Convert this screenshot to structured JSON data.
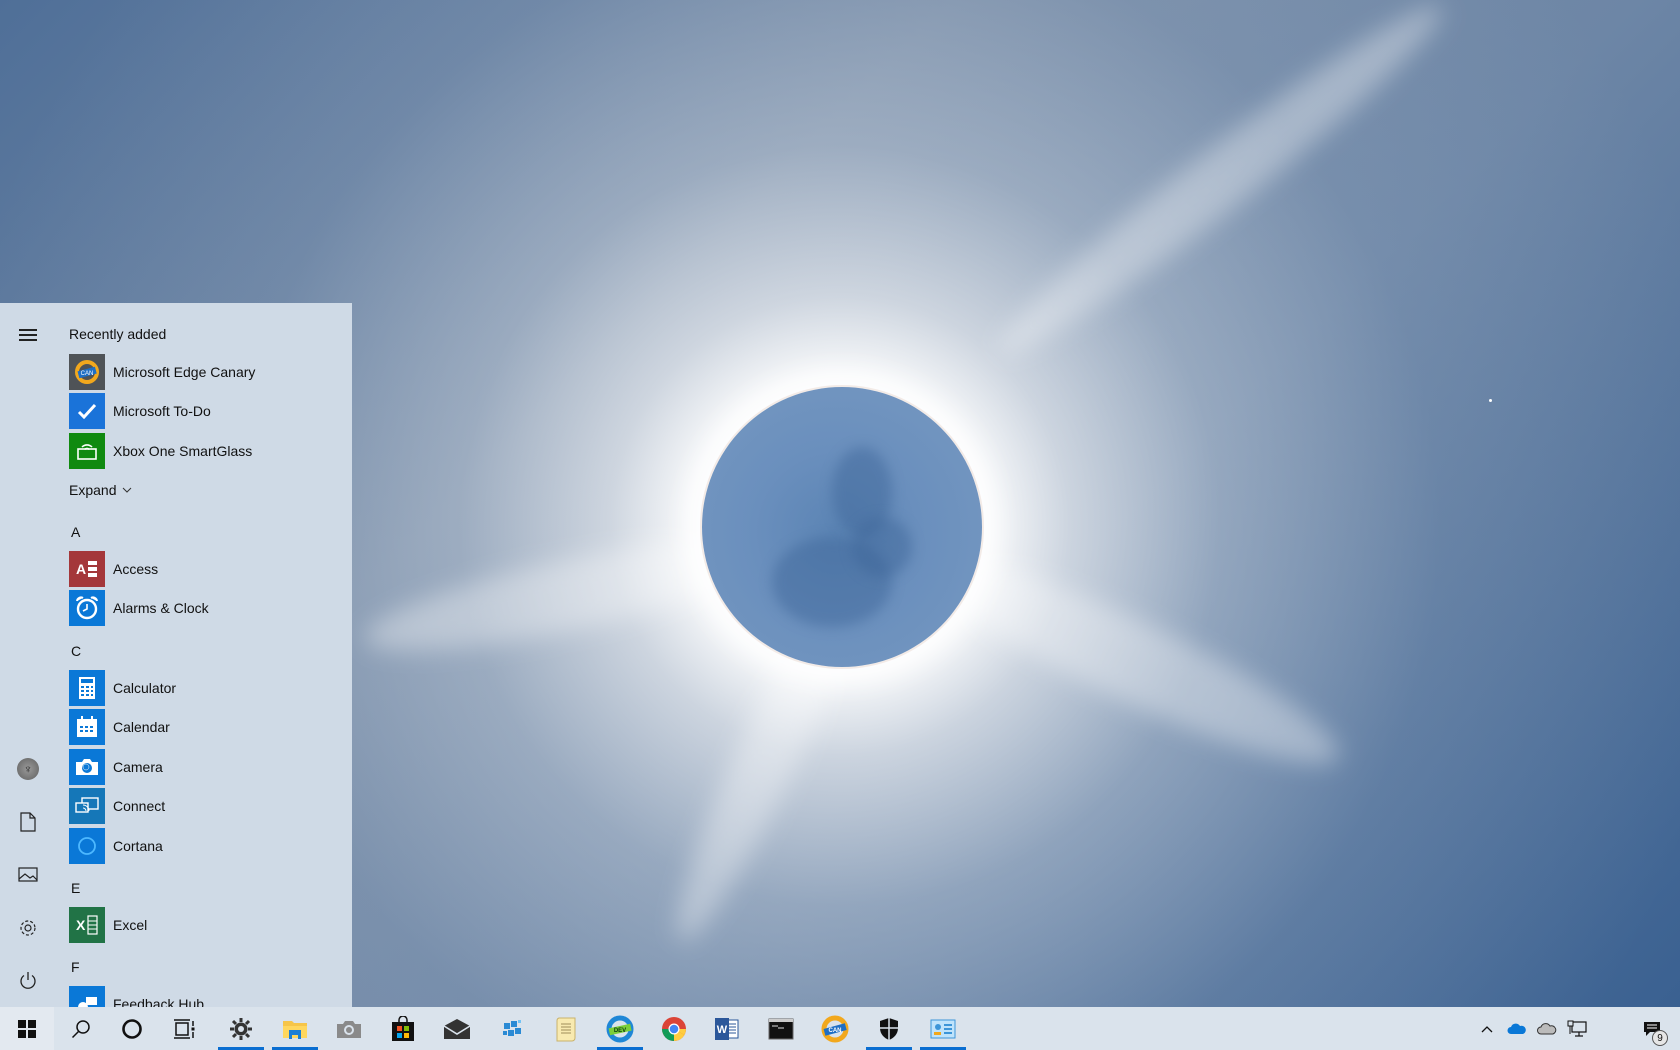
{
  "wallpaper": {
    "subject": "total solar eclipse"
  },
  "start_menu": {
    "rail": {
      "items": [
        {
          "name": "expand-menu",
          "icon": "hamburger-icon"
        },
        {
          "name": "user-account",
          "icon": "avatar-icon"
        },
        {
          "name": "documents",
          "icon": "document-icon"
        },
        {
          "name": "pictures",
          "icon": "pictures-icon"
        },
        {
          "name": "settings",
          "icon": "gear-icon"
        },
        {
          "name": "power",
          "icon": "power-icon"
        }
      ]
    },
    "recently_added": {
      "heading": "Recently added",
      "items": [
        {
          "label": "Microsoft Edge Canary",
          "icon": "edge-canary-icon",
          "color": "#4f5357"
        },
        {
          "label": "Microsoft To-Do",
          "icon": "todo-icon",
          "color": "#1a73d9"
        },
        {
          "label": "Xbox One SmartGlass",
          "icon": "xbox-smartglass-icon",
          "color": "#108a10"
        }
      ],
      "expand_label": "Expand"
    },
    "sections": [
      {
        "letter": "A",
        "items": [
          {
            "label": "Access",
            "icon": "access-icon",
            "color": "#a4373a"
          },
          {
            "label": "Alarms & Clock",
            "icon": "alarm-clock-icon",
            "color": "#0a78d7"
          }
        ]
      },
      {
        "letter": "C",
        "items": [
          {
            "label": "Calculator",
            "icon": "calculator-icon",
            "color": "#0a78d7"
          },
          {
            "label": "Calendar",
            "icon": "calendar-icon",
            "color": "#0a78d7"
          },
          {
            "label": "Camera",
            "icon": "camera-icon",
            "color": "#0a78d7"
          },
          {
            "label": "Connect",
            "icon": "connect-icon",
            "color": "#1577b8"
          },
          {
            "label": "Cortana",
            "icon": "cortana-icon",
            "color": "#0a78d7"
          }
        ]
      },
      {
        "letter": "E",
        "items": [
          {
            "label": "Excel",
            "icon": "excel-icon",
            "color": "#217346"
          }
        ]
      },
      {
        "letter": "F",
        "items": [
          {
            "label": "Feedback Hub",
            "icon": "feedback-hub-icon",
            "color": "#0a78d7"
          }
        ]
      }
    ]
  },
  "taskbar": {
    "pinned": [
      {
        "name": "start",
        "icon": "windows-logo-icon",
        "active": false
      },
      {
        "name": "search",
        "icon": "search-icon",
        "active": false
      },
      {
        "name": "cortana",
        "icon": "cortana-ring-icon",
        "active": false
      },
      {
        "name": "task-view",
        "icon": "task-view-icon",
        "active": false
      },
      {
        "name": "settings",
        "icon": "gear-icon",
        "active": true
      },
      {
        "name": "file-explorer",
        "icon": "folder-icon",
        "active": true
      },
      {
        "name": "camera",
        "icon": "camera-icon",
        "active": false
      },
      {
        "name": "microsoft-store",
        "icon": "store-icon",
        "active": false
      },
      {
        "name": "mail",
        "icon": "mail-icon",
        "active": false
      },
      {
        "name": "azure-app",
        "icon": "cubes-icon",
        "active": false
      },
      {
        "name": "notepad-app",
        "icon": "scroll-icon",
        "active": false
      },
      {
        "name": "edge-dev",
        "icon": "edge-dev-icon",
        "active": true
      },
      {
        "name": "chrome",
        "icon": "chrome-icon",
        "active": false
      },
      {
        "name": "word",
        "icon": "word-icon",
        "active": false
      },
      {
        "name": "terminal",
        "icon": "terminal-icon",
        "active": false
      },
      {
        "name": "edge-canary",
        "icon": "edge-canary-icon",
        "active": false
      },
      {
        "name": "windows-security",
        "icon": "shield-icon",
        "active": true
      },
      {
        "name": "control-panel",
        "icon": "control-panel-icon",
        "active": true
      }
    ],
    "tray": {
      "items": [
        {
          "name": "show-hidden-icons",
          "icon": "chevron-up-icon"
        },
        {
          "name": "onedrive-personal",
          "icon": "cloud-blue-icon"
        },
        {
          "name": "onedrive-business",
          "icon": "cloud-gray-icon"
        },
        {
          "name": "network",
          "icon": "network-icon"
        }
      ],
      "notifications_count": "9"
    }
  }
}
